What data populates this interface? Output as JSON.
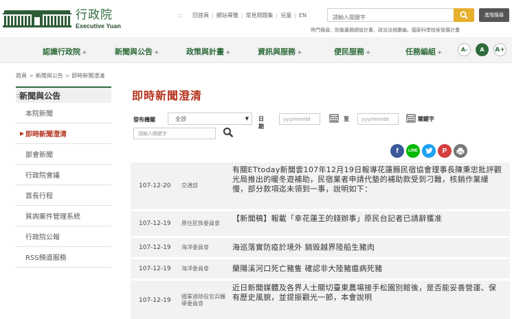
{
  "header": {
    "logo_zh": "行政院",
    "logo_en": "Executive Yuan",
    "top_links": [
      "回首頁",
      "網站導覽",
      "常見問題集",
      "兒童",
      "EN"
    ],
    "search_placeholder": "請輸入關鍵字",
    "advanced_search": "進階搜尋",
    "hot_keywords": "熱門搜尋：防颱專題網設計書、政治法規彙編、國家科學技術發展計畫"
  },
  "nav": {
    "items": [
      "認識行政院",
      "新聞與公告",
      "政策與計畫",
      "資訊與服務",
      "便民服務",
      "任務編組"
    ],
    "plus": "+",
    "font_small": "A-",
    "font_mid": "A",
    "font_large": "A+"
  },
  "breadcrumb": [
    "首頁",
    "新聞與公告",
    "即時新聞澄清"
  ],
  "sidebar": {
    "title": "新聞與公告",
    "items": [
      "本院新聞",
      "即時新聞澄清",
      "部會新聞",
      "行政院會議",
      "首長行程",
      "質詢案件管理系統",
      "行政院公報",
      "RSS頻道服務"
    ],
    "active_index": 1
  },
  "main": {
    "title": "即時新聞澄清",
    "filter": {
      "org_label": "發布機關",
      "org_value": "全部",
      "date_label": "日期",
      "date_placeholder": "yyy/mm/dd",
      "to_label": "至",
      "keyword_label": "關鍵字",
      "keyword_placeholder": "請輸入關鍵字"
    },
    "share_icons": [
      "facebook",
      "line",
      "twitter",
      "plurk",
      "print"
    ]
  },
  "news": [
    {
      "date": "107-12-20",
      "dept": "交通部",
      "title": "有關ETtoday新聞雲107年12月19日報導花蓮縣民宿協會理事長陳秉忠批評觀光局推出的暖冬遊補助，民宿業者申請代墊的補助款受到刁難，核銷作業緩慢，部分款項迄未領到一事，說明如下："
    },
    {
      "date": "107-12-19",
      "dept": "原住民族委員會",
      "title": "【新聞稿】報載「幸花蓮王的錢辦事」原民台記者已請辭獲准"
    },
    {
      "date": "107-12-19",
      "dept": "海洋委員會",
      "title": "海巡落實防疫於境外 銷毀越界陸船生豬肉"
    },
    {
      "date": "107-12-19",
      "dept": "海洋委員會",
      "title": "蘭陽溪河口死亡豬隻 確認非大陸豬瘟病死豬"
    },
    {
      "date": "107-12-19",
      "dept": "國軍退除役官兵輔導委員會",
      "title": "近日新聞媒體及各界人士關切臺東農場接手松園別館後，是否能妥善營運、保有歷史風貌，並提振觀光一節，本會說明"
    }
  ],
  "colors": {
    "brand_green": "#2e6b3a",
    "accent_red": "#b5331e",
    "search_yellow": "#e5b02b"
  }
}
